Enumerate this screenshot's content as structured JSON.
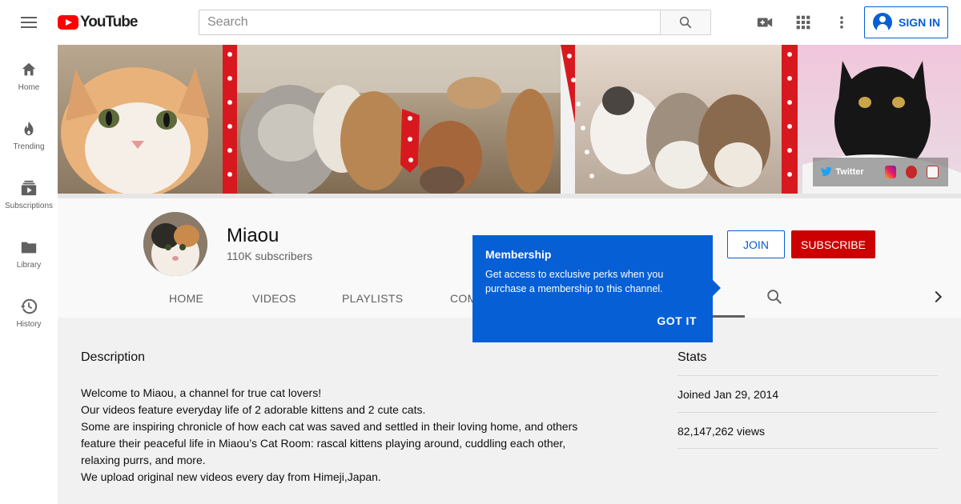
{
  "header": {
    "logo_text": "YouTube",
    "search_placeholder": "Search",
    "signin_label": "SIGN IN"
  },
  "sidebar": {
    "items": [
      {
        "label": "Home",
        "icon": "home-icon"
      },
      {
        "label": "Trending",
        "icon": "trending-icon"
      },
      {
        "label": "Subscriptions",
        "icon": "subscriptions-icon"
      },
      {
        "label": "Library",
        "icon": "library-icon"
      },
      {
        "label": "History",
        "icon": "history-icon"
      }
    ]
  },
  "banner": {
    "social_twitter": "Twitter"
  },
  "channel": {
    "name": "Miaou",
    "subscribers": "110K subscribers",
    "join_label": "JOIN",
    "subscribe_label": "SUBSCRIBE",
    "tabs": [
      "HOME",
      "VIDEOS",
      "PLAYLISTS",
      "COM"
    ]
  },
  "tooltip": {
    "title": "Membership",
    "body": "Get access to exclusive perks when you purchase a membership to this channel.",
    "button": "GOT IT"
  },
  "about": {
    "description_title": "Description",
    "description_lines": [
      "Welcome to Miaou, a channel for true cat lovers!",
      "Our videos feature everyday life of 2 adorable kittens and 2 cute cats.",
      "Some are inspiring chronicle of how each cat was saved and settled in their loving home, and others",
      "feature their peaceful life in Miaou’s Cat Room: rascal kittens playing around, cuddling each other,",
      "relaxing purrs, and more.",
      "We upload original new videos every day from Himeji,Japan."
    ],
    "stats_title": "Stats",
    "joined": "Joined Jan 29, 2014",
    "views": "82,147,262 views"
  },
  "colors": {
    "brand_red": "#ff0000",
    "subscribe_red": "#cc0000",
    "accent_blue": "#065fd4"
  }
}
